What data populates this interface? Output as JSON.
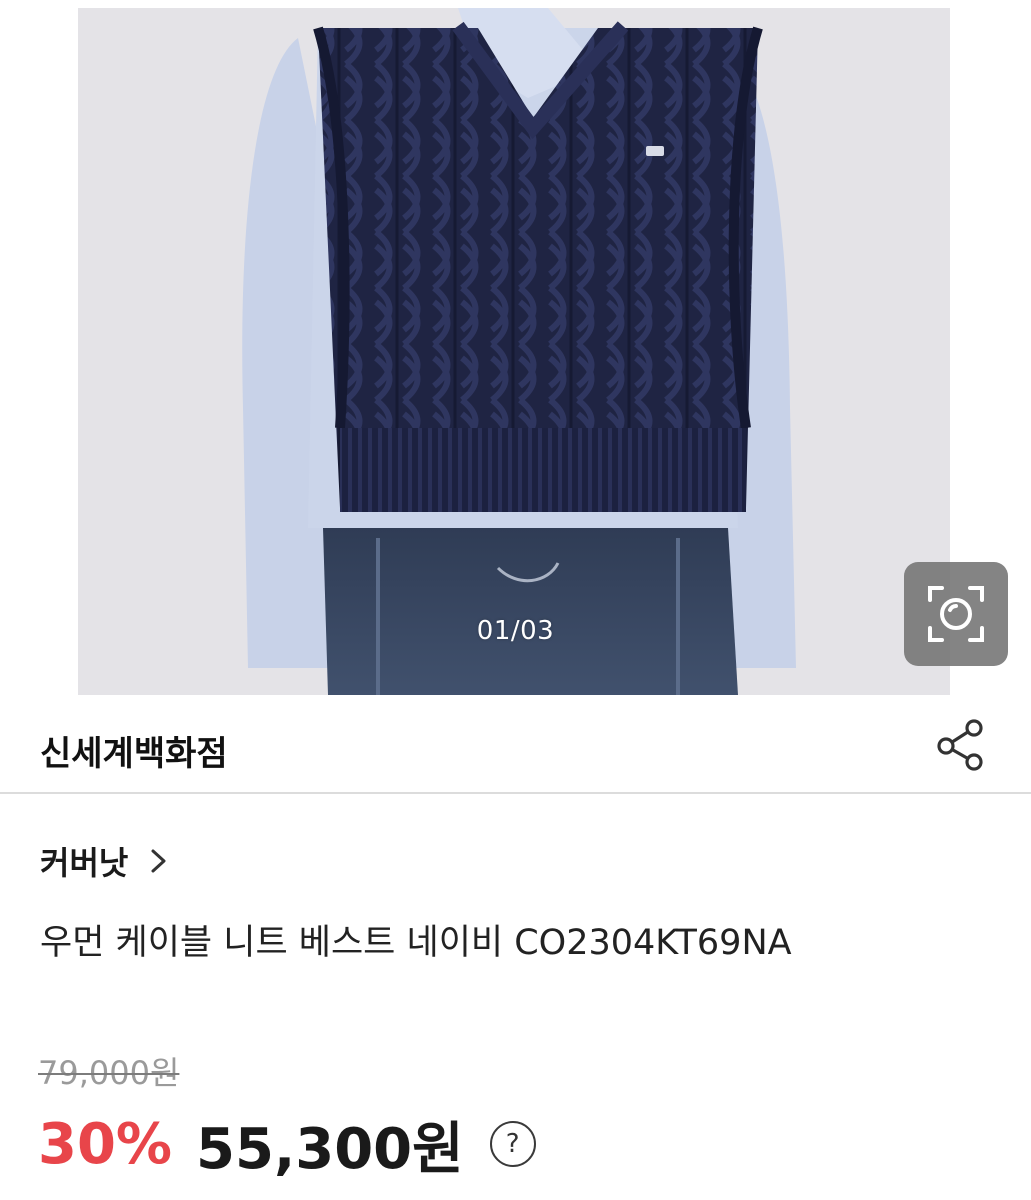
{
  "carousel": {
    "counter": "01/03",
    "current": 1,
    "total": 3,
    "lens_icon": "camera-lens-search-icon"
  },
  "store": {
    "name": "신세계백화점",
    "share_icon": "share-icon"
  },
  "product": {
    "brand": "커버낫",
    "brand_chevron": ">",
    "title": "우먼 케이블 니트 베스트 네이비 CO2304KT69NA",
    "original_price": "79,000원",
    "discount": "30%",
    "sale_price": "55,300원",
    "help_icon": "?"
  },
  "colors": {
    "discount": "#e8454a",
    "text": "#1a1a1a",
    "muted": "#9a9a9a",
    "divider": "#dcdcdc",
    "vest": "#1e2340",
    "shirt": "#c9d4ea",
    "denim": "#3a4a62"
  }
}
